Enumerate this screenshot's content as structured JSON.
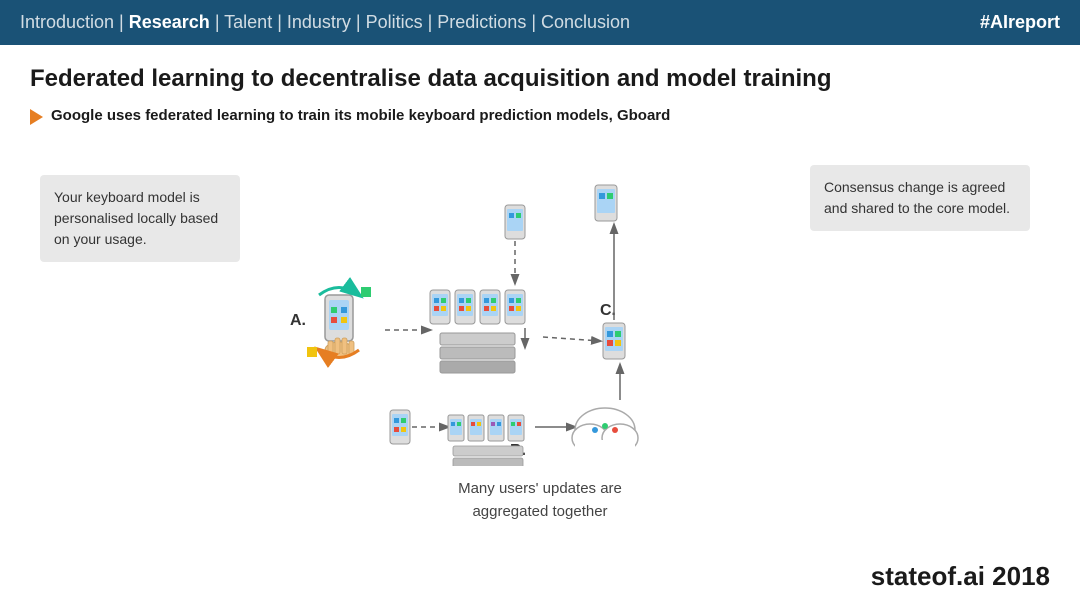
{
  "header": {
    "nav": "Introduction | Research | Talent | Industry | Politics | Predictions | Conclusion",
    "nav_parts": [
      {
        "label": "Introduction",
        "bold": false
      },
      {
        "label": " | ",
        "bold": false
      },
      {
        "label": "Research",
        "bold": true
      },
      {
        "label": " | Talent | Industry | Politics | Predictions | Conclusion",
        "bold": false
      }
    ],
    "hashtag": "#AIreport"
  },
  "main": {
    "title": "Federated learning to decentralise data acquisition and model training",
    "subtitle": "Google uses federated learning to train its mobile keyboard prediction models, Gboard"
  },
  "boxes": {
    "left": "Your keyboard model is personalised locally based on your usage.",
    "right": "Consensus change is agreed and shared to the core model.",
    "bottom": "Many users' updates are aggregated together"
  },
  "labels": {
    "a": "A.",
    "b": "B.",
    "c": "C."
  },
  "footer": {
    "text": "stateof.ai 2018"
  }
}
